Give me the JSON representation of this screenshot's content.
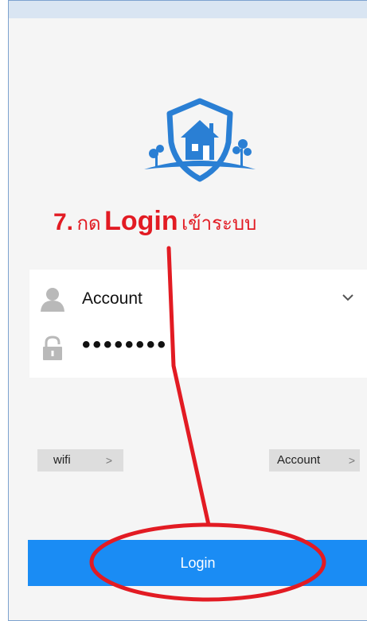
{
  "annotation": {
    "step": "7.",
    "thai_press": "กด",
    "keyword": "Login",
    "thai_enter": "เข้าระบบ"
  },
  "form": {
    "account_value": "Account",
    "password_value": "••••••••"
  },
  "links": {
    "wifi_label": "wifi",
    "wifi_arrow": ">",
    "account_label": "Account",
    "account_arrow": ">"
  },
  "login_button": {
    "label": "Login"
  },
  "icons": {
    "logo": "shield-house-logo-icon",
    "account": "user-icon",
    "password": "lock-icon",
    "dropdown": "chevron-down-icon"
  },
  "colors": {
    "primary": "#1a8cf4",
    "annotation": "#e21b23",
    "logo": "#2a7fd4"
  }
}
